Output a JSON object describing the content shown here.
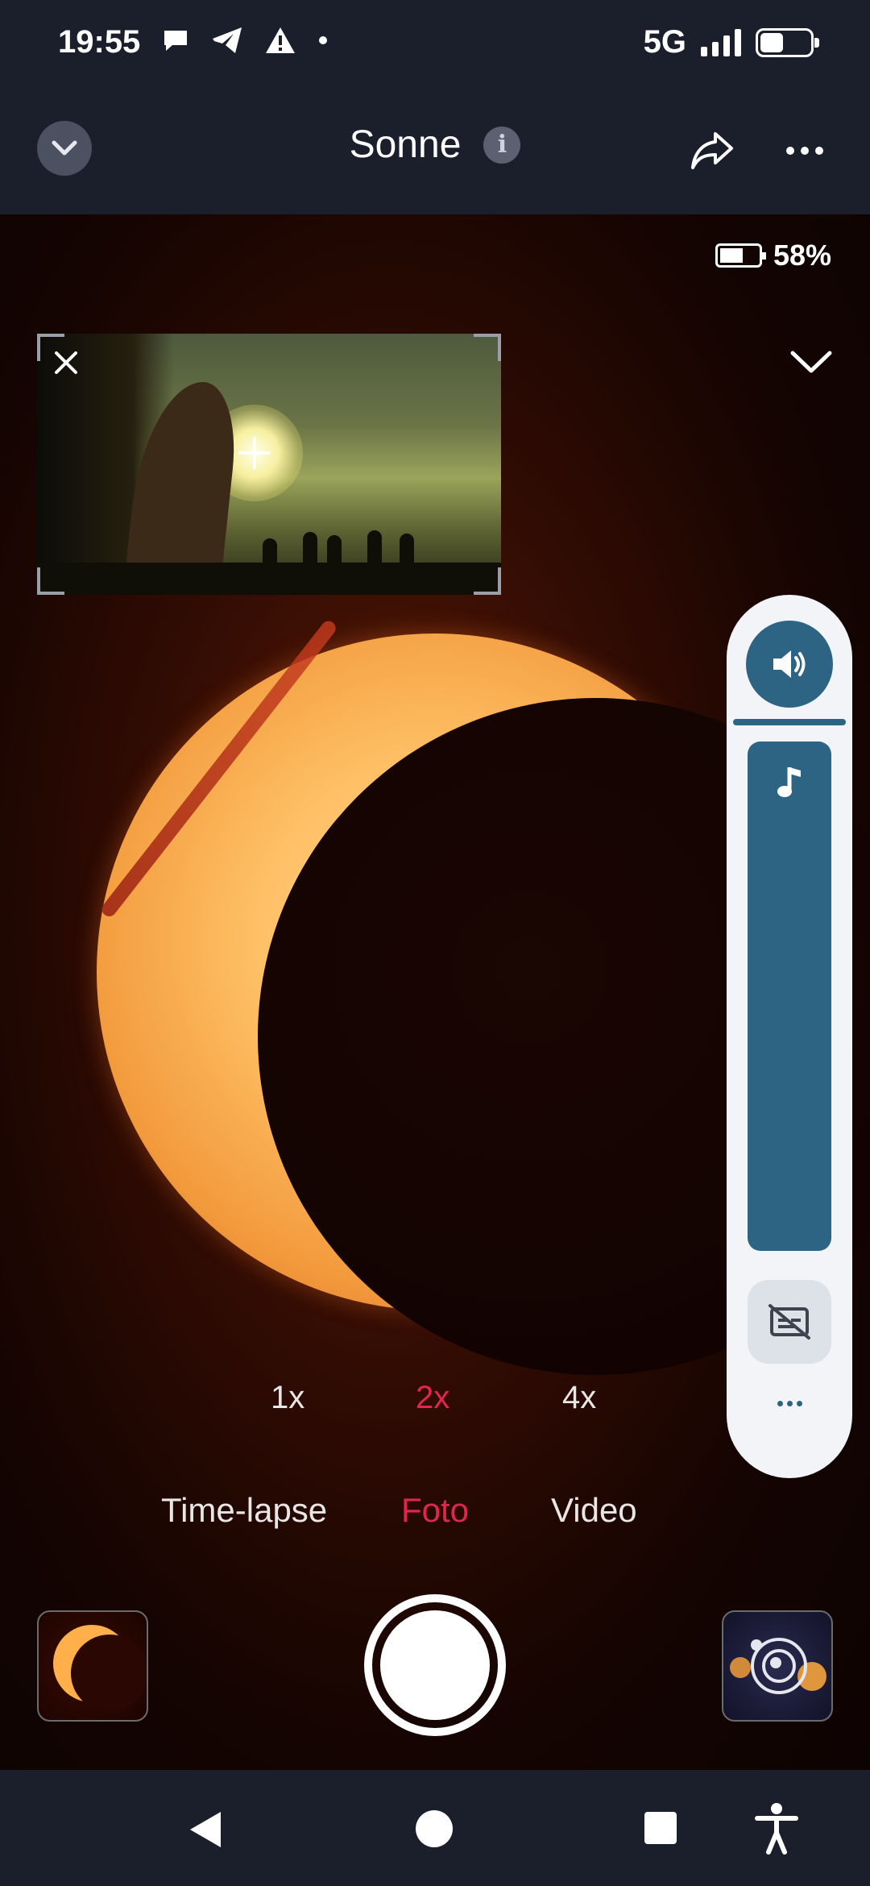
{
  "status_bar": {
    "time": "19:55",
    "network": "5G",
    "icons": [
      "chat-bubble-icon",
      "telegram-icon",
      "warning-icon",
      "dot-icon",
      "signal-icon",
      "battery-icon"
    ]
  },
  "app_bar": {
    "title": "Sonne",
    "info_label": "i"
  },
  "viewfinder": {
    "battery_percent": "58%",
    "zoom_options": [
      "1x",
      "2x",
      "4x"
    ],
    "zoom_selected": "2x",
    "modes": [
      "Time-lapse",
      "Foto",
      "Video"
    ],
    "mode_selected": "Foto"
  },
  "side_panel": {
    "icons": [
      "volume-icon",
      "music-note-icon",
      "captions-off-icon",
      "more-horizontal-icon"
    ]
  },
  "colors": {
    "accent_active": "#e0264a",
    "panel_blue": "#2d6484",
    "bar_bg": "#1b1f2b"
  }
}
